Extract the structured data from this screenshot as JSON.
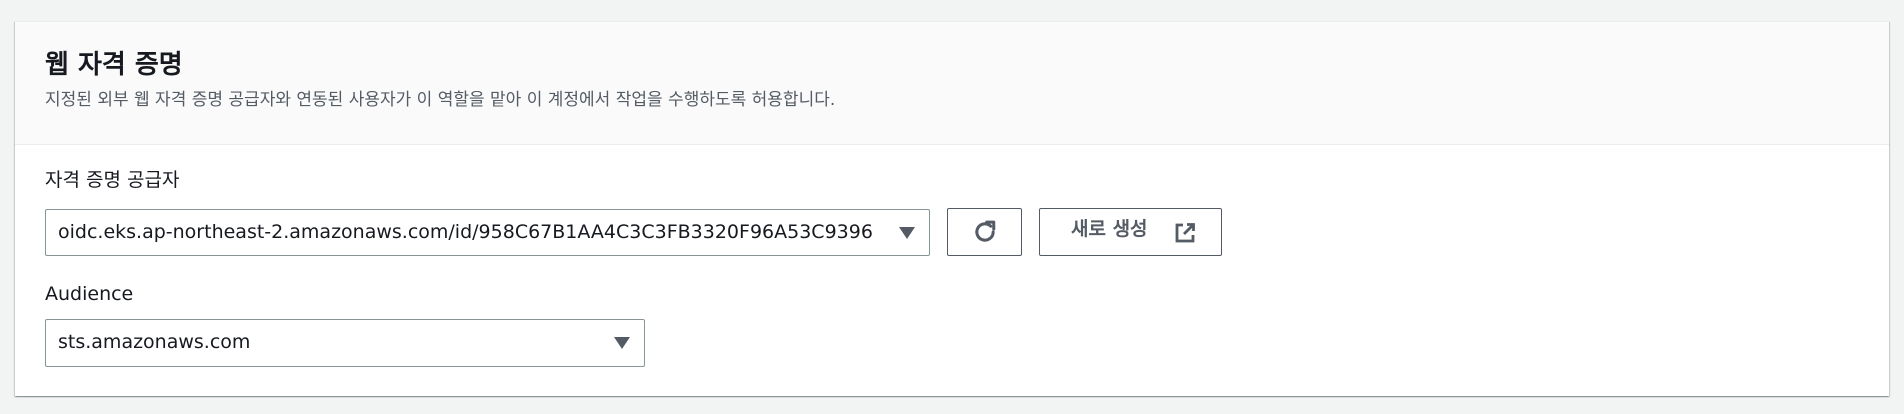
{
  "section": {
    "title": "웹 자격 증명",
    "description": "지정된 외부 웹 자격 증명 공급자와 연동된 사용자가 이 역할을 맡아 이 계정에서 작업을 수행하도록 허용합니다."
  },
  "provider": {
    "label": "자격 증명 공급자",
    "selected": "oidc.eks.ap-northeast-2.amazonaws.com/id/958C67B1AA4C3C3FB3320F96A53C9396",
    "refresh_icon": "refresh-icon",
    "create_label": "새로 생성",
    "external_icon": "external-link-icon"
  },
  "audience": {
    "label": "Audience",
    "selected": "sts.amazonaws.com"
  },
  "colors": {
    "text": "#16191f",
    "secondary_text": "#545b64",
    "border": "#879596",
    "page_bg": "#f2f3f3",
    "header_bg": "#fafafa"
  }
}
